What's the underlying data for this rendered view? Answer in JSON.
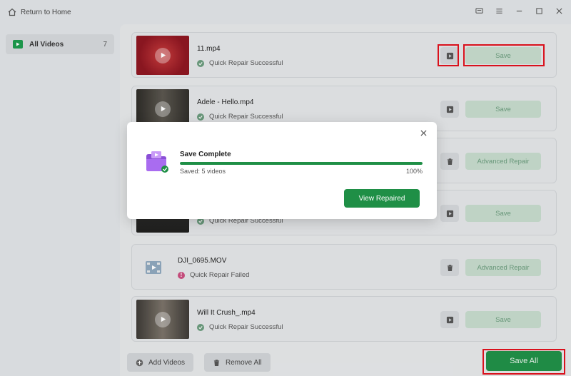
{
  "topbar": {
    "home_label": "Return to Home",
    "icons": [
      "home-icon",
      "feedback-icon",
      "menu-icon",
      "minimize-icon",
      "maximize-icon",
      "close-icon"
    ]
  },
  "sidebar": {
    "items": [
      {
        "label": "All Videos",
        "count": "7",
        "icon": "video-icon"
      }
    ]
  },
  "videos": [
    {
      "name": "11.mp4",
      "status": "Quick Repair Successful",
      "status_type": "success",
      "action": "Save",
      "icon": "play-icon",
      "thumb_color": "#9b1a24"
    },
    {
      "name": "Adele - Hello.mp4",
      "status": "Quick Repair Successful",
      "status_type": "success",
      "action": "Save",
      "icon": "play-icon",
      "thumb_color": "#3a3834"
    },
    {
      "name": "",
      "status": "",
      "status_type": "failed",
      "action": "Advanced Repair",
      "icon": "trash-icon",
      "thumb_color": ""
    },
    {
      "name": "",
      "status": "Quick Repair Successful",
      "status_type": "success",
      "action": "Save",
      "icon": "play-icon",
      "thumb_color": "#2b2b2a"
    },
    {
      "name": "DJI_0695.MOV",
      "status": "Quick Repair Failed",
      "status_type": "failed",
      "action": "Advanced Repair",
      "icon": "trash-icon",
      "thumb_color": ""
    },
    {
      "name": "Will It Crush_.mp4",
      "status": "Quick Repair Successful",
      "status_type": "success",
      "action": "Save",
      "icon": "play-icon",
      "thumb_color": "#4a4642"
    }
  ],
  "footer": {
    "add_label": "Add Videos",
    "remove_label": "Remove All",
    "save_all_label": "Save All"
  },
  "dialog": {
    "title": "Save Complete",
    "saved_text": "Saved: 5 videos",
    "percent_text": "100%",
    "progress": 1.0,
    "button_label": "View Repaired"
  },
  "colors": {
    "accent": "#1f8f46",
    "success": "#6a9b7c",
    "failed": "#c94e7e",
    "highlight": "#e0101c"
  }
}
